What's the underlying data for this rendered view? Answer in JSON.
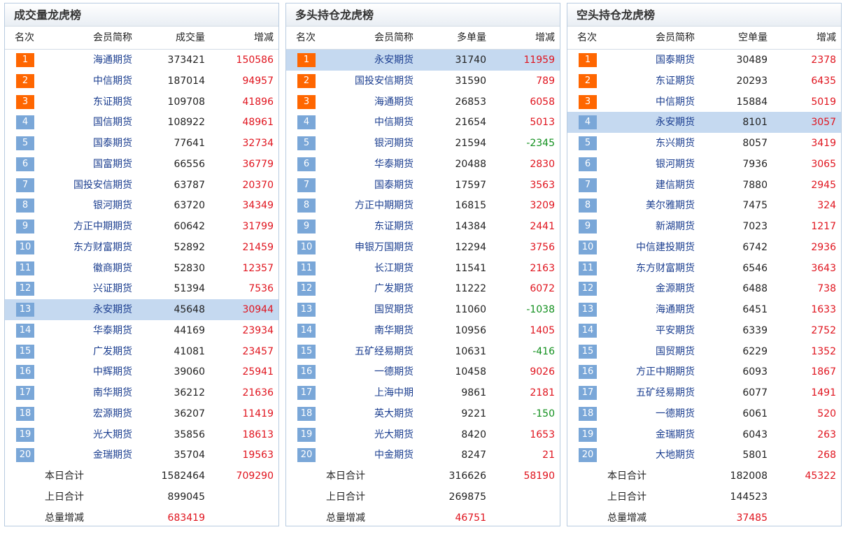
{
  "panels": [
    {
      "title": "成交量龙虎榜",
      "headers": {
        "rank": "名次",
        "member": "会员简称",
        "value": "成交量",
        "change": "增减"
      },
      "highlight_rank": 13,
      "rows": [
        {
          "rank": "1",
          "member": "海通期货",
          "value": "373421",
          "change": "150586"
        },
        {
          "rank": "2",
          "member": "中信期货",
          "value": "187014",
          "change": "94957"
        },
        {
          "rank": "3",
          "member": "东证期货",
          "value": "109708",
          "change": "41896"
        },
        {
          "rank": "4",
          "member": "国信期货",
          "value": "108922",
          "change": "48961"
        },
        {
          "rank": "5",
          "member": "国泰期货",
          "value": "77641",
          "change": "32734"
        },
        {
          "rank": "6",
          "member": "国富期货",
          "value": "66556",
          "change": "36779"
        },
        {
          "rank": "7",
          "member": "国投安信期货",
          "value": "63787",
          "change": "20370"
        },
        {
          "rank": "8",
          "member": "银河期货",
          "value": "63720",
          "change": "34349"
        },
        {
          "rank": "9",
          "member": "方正中期期货",
          "value": "60642",
          "change": "31799"
        },
        {
          "rank": "10",
          "member": "东方财富期货",
          "value": "52892",
          "change": "21459"
        },
        {
          "rank": "11",
          "member": "徽商期货",
          "value": "52830",
          "change": "12357"
        },
        {
          "rank": "12",
          "member": "兴证期货",
          "value": "51394",
          "change": "7536"
        },
        {
          "rank": "13",
          "member": "永安期货",
          "value": "45648",
          "change": "30944"
        },
        {
          "rank": "14",
          "member": "华泰期货",
          "value": "44169",
          "change": "23934"
        },
        {
          "rank": "15",
          "member": "广发期货",
          "value": "41081",
          "change": "23457"
        },
        {
          "rank": "16",
          "member": "中辉期货",
          "value": "39060",
          "change": "25941"
        },
        {
          "rank": "17",
          "member": "南华期货",
          "value": "36212",
          "change": "21636"
        },
        {
          "rank": "18",
          "member": "宏源期货",
          "value": "36207",
          "change": "11419"
        },
        {
          "rank": "19",
          "member": "光大期货",
          "value": "35856",
          "change": "18613"
        },
        {
          "rank": "20",
          "member": "金瑞期货",
          "value": "35704",
          "change": "19563"
        }
      ],
      "summary": {
        "today_label": "本日合计",
        "today_value": "1582464",
        "today_change": "709290",
        "prev_label": "上日合计",
        "prev_value": "899045",
        "diff_label": "总量增减",
        "diff_value": "683419"
      }
    },
    {
      "title": "多头持仓龙虎榜",
      "headers": {
        "rank": "名次",
        "member": "会员简称",
        "value": "多单量",
        "change": "增减"
      },
      "highlight_rank": 1,
      "rows": [
        {
          "rank": "1",
          "member": "永安期货",
          "value": "31740",
          "change": "11959"
        },
        {
          "rank": "2",
          "member": "国投安信期货",
          "value": "31590",
          "change": "789"
        },
        {
          "rank": "3",
          "member": "海通期货",
          "value": "26853",
          "change": "6058"
        },
        {
          "rank": "4",
          "member": "中信期货",
          "value": "21654",
          "change": "5013"
        },
        {
          "rank": "5",
          "member": "银河期货",
          "value": "21594",
          "change": "-2345"
        },
        {
          "rank": "6",
          "member": "华泰期货",
          "value": "20488",
          "change": "2830"
        },
        {
          "rank": "7",
          "member": "国泰期货",
          "value": "17597",
          "change": "3563"
        },
        {
          "rank": "8",
          "member": "方正中期期货",
          "value": "16815",
          "change": "3209"
        },
        {
          "rank": "9",
          "member": "东证期货",
          "value": "14384",
          "change": "2441"
        },
        {
          "rank": "10",
          "member": "申银万国期货",
          "value": "12294",
          "change": "3756"
        },
        {
          "rank": "11",
          "member": "长江期货",
          "value": "11541",
          "change": "2163"
        },
        {
          "rank": "12",
          "member": "广发期货",
          "value": "11222",
          "change": "6072"
        },
        {
          "rank": "13",
          "member": "国贸期货",
          "value": "11060",
          "change": "-1038"
        },
        {
          "rank": "14",
          "member": "南华期货",
          "value": "10956",
          "change": "1405"
        },
        {
          "rank": "15",
          "member": "五矿经易期货",
          "value": "10631",
          "change": "-416"
        },
        {
          "rank": "16",
          "member": "一德期货",
          "value": "10458",
          "change": "9026"
        },
        {
          "rank": "17",
          "member": "上海中期",
          "value": "9861",
          "change": "2181"
        },
        {
          "rank": "18",
          "member": "英大期货",
          "value": "9221",
          "change": "-150"
        },
        {
          "rank": "19",
          "member": "光大期货",
          "value": "8420",
          "change": "1653"
        },
        {
          "rank": "20",
          "member": "中金期货",
          "value": "8247",
          "change": "21"
        }
      ],
      "summary": {
        "today_label": "本日合计",
        "today_value": "316626",
        "today_change": "58190",
        "prev_label": "上日合计",
        "prev_value": "269875",
        "diff_label": "总量增减",
        "diff_value": "46751"
      }
    },
    {
      "title": "空头持仓龙虎榜",
      "headers": {
        "rank": "名次",
        "member": "会员简称",
        "value": "空单量",
        "change": "增减"
      },
      "highlight_rank": 4,
      "rows": [
        {
          "rank": "1",
          "member": "国泰期货",
          "value": "30489",
          "change": "2378"
        },
        {
          "rank": "2",
          "member": "东证期货",
          "value": "20293",
          "change": "6435"
        },
        {
          "rank": "3",
          "member": "中信期货",
          "value": "15884",
          "change": "5019"
        },
        {
          "rank": "4",
          "member": "永安期货",
          "value": "8101",
          "change": "3057"
        },
        {
          "rank": "5",
          "member": "东兴期货",
          "value": "8057",
          "change": "3419"
        },
        {
          "rank": "6",
          "member": "银河期货",
          "value": "7936",
          "change": "3065"
        },
        {
          "rank": "7",
          "member": "建信期货",
          "value": "7880",
          "change": "2945"
        },
        {
          "rank": "8",
          "member": "美尔雅期货",
          "value": "7475",
          "change": "324"
        },
        {
          "rank": "9",
          "member": "新湖期货",
          "value": "7023",
          "change": "1217"
        },
        {
          "rank": "10",
          "member": "中信建投期货",
          "value": "6742",
          "change": "2936"
        },
        {
          "rank": "11",
          "member": "东方财富期货",
          "value": "6546",
          "change": "3643"
        },
        {
          "rank": "12",
          "member": "金源期货",
          "value": "6488",
          "change": "738"
        },
        {
          "rank": "13",
          "member": "海通期货",
          "value": "6451",
          "change": "1633"
        },
        {
          "rank": "14",
          "member": "平安期货",
          "value": "6339",
          "change": "2752"
        },
        {
          "rank": "15",
          "member": "国贸期货",
          "value": "6229",
          "change": "1352"
        },
        {
          "rank": "16",
          "member": "方正中期期货",
          "value": "6093",
          "change": "1867"
        },
        {
          "rank": "17",
          "member": "五矿经易期货",
          "value": "6077",
          "change": "1491"
        },
        {
          "rank": "18",
          "member": "一德期货",
          "value": "6061",
          "change": "520"
        },
        {
          "rank": "19",
          "member": "金瑞期货",
          "value": "6043",
          "change": "263"
        },
        {
          "rank": "20",
          "member": "大地期货",
          "value": "5801",
          "change": "268"
        }
      ],
      "summary": {
        "today_label": "本日合计",
        "today_value": "182008",
        "today_change": "45322",
        "prev_label": "上日合计",
        "prev_value": "144523",
        "diff_label": "总量增减",
        "diff_value": "37485"
      }
    }
  ]
}
